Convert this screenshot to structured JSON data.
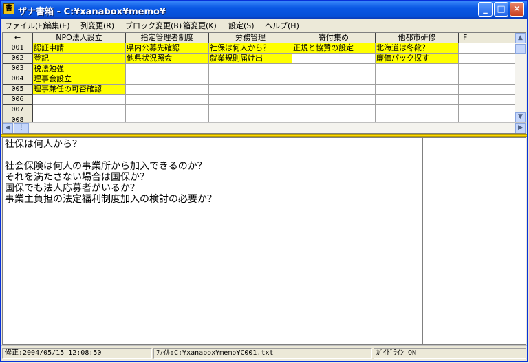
{
  "window": {
    "title": "ザナ書箱 - C:¥xanabox¥memo¥",
    "app_icon_glyph": "書",
    "minimize_glyph": "_",
    "maximize_glyph": "□",
    "close_glyph": "✕"
  },
  "menu": [
    "ファイル(F)",
    "編集(E)",
    "列変更(R)",
    "ブロック変更(B)",
    "箱変更(K)",
    "設定(S)",
    "ヘルプ(H)"
  ],
  "grid": {
    "corner": "←",
    "columns": [
      "NPO法人設立",
      "指定管理者制度",
      "労務管理",
      "寄付集め",
      "他都市研修",
      "F"
    ],
    "rows": [
      {
        "id": "001",
        "cells": [
          "認証申請",
          "県内公募先確認",
          "社保は何人から？",
          "正規と協賛の設定",
          "北海道は冬靴？",
          ""
        ]
      },
      {
        "id": "002",
        "cells": [
          "登記",
          "他県状況照会",
          "就業規則届け出",
          "",
          "廉価パック探す",
          ""
        ]
      },
      {
        "id": "003",
        "cells": [
          "税法勉強",
          "",
          "",
          "",
          "",
          ""
        ]
      },
      {
        "id": "004",
        "cells": [
          "理事会設立",
          "",
          "",
          "",
          "",
          ""
        ]
      },
      {
        "id": "005",
        "cells": [
          "理事兼任の可否確認",
          "",
          "",
          "",
          "",
          ""
        ]
      },
      {
        "id": "006",
        "cells": [
          "",
          "",
          "",
          "",
          "",
          ""
        ]
      },
      {
        "id": "007",
        "cells": [
          "",
          "",
          "",
          "",
          "",
          ""
        ]
      },
      {
        "id": "008",
        "cells": [
          "",
          "",
          "",
          "",
          "",
          ""
        ]
      }
    ],
    "highlight_color": "#ffff00"
  },
  "memo": {
    "lines": [
      "社保は何人から？",
      "",
      "社会保険は何人の事業所から加入できるのか？",
      "それを満たさない場合は国保か？",
      "国保でも法人応募者がいるか？",
      "事業主負担の法定福利制度加入の検討の必要か？"
    ]
  },
  "status": {
    "modified": "修正:2004/05/15 12:08:50",
    "file": "ﾌｧｲﾙ:C:¥xanabox¥memo¥C001.txt",
    "guideline": "ｶﾞｲﾄﾞﾗｲﾝ ON"
  },
  "colors": {
    "accent": "#0a58e4",
    "splitter": "#ffd700"
  }
}
